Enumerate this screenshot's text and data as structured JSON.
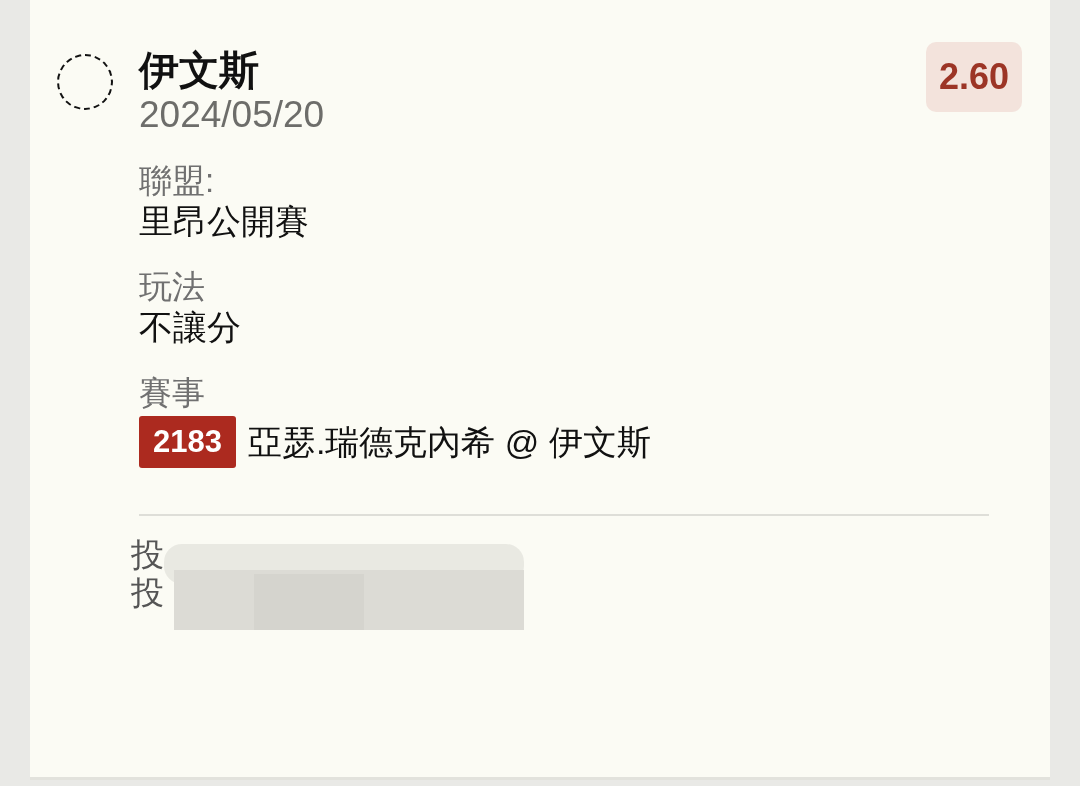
{
  "bet": {
    "title": "伊文斯",
    "date": "2024/05/20",
    "odds": "2.60",
    "fields": [
      {
        "label": "聯盟:",
        "value": "里昂公開賽"
      },
      {
        "label": "玩法",
        "value": "不讓分"
      }
    ],
    "event": {
      "label": "賽事",
      "number": "2183",
      "matchup": "亞瑟.瑞德克內希 @ 伊文斯"
    },
    "footer_lines": [
      "投",
      "投"
    ]
  }
}
